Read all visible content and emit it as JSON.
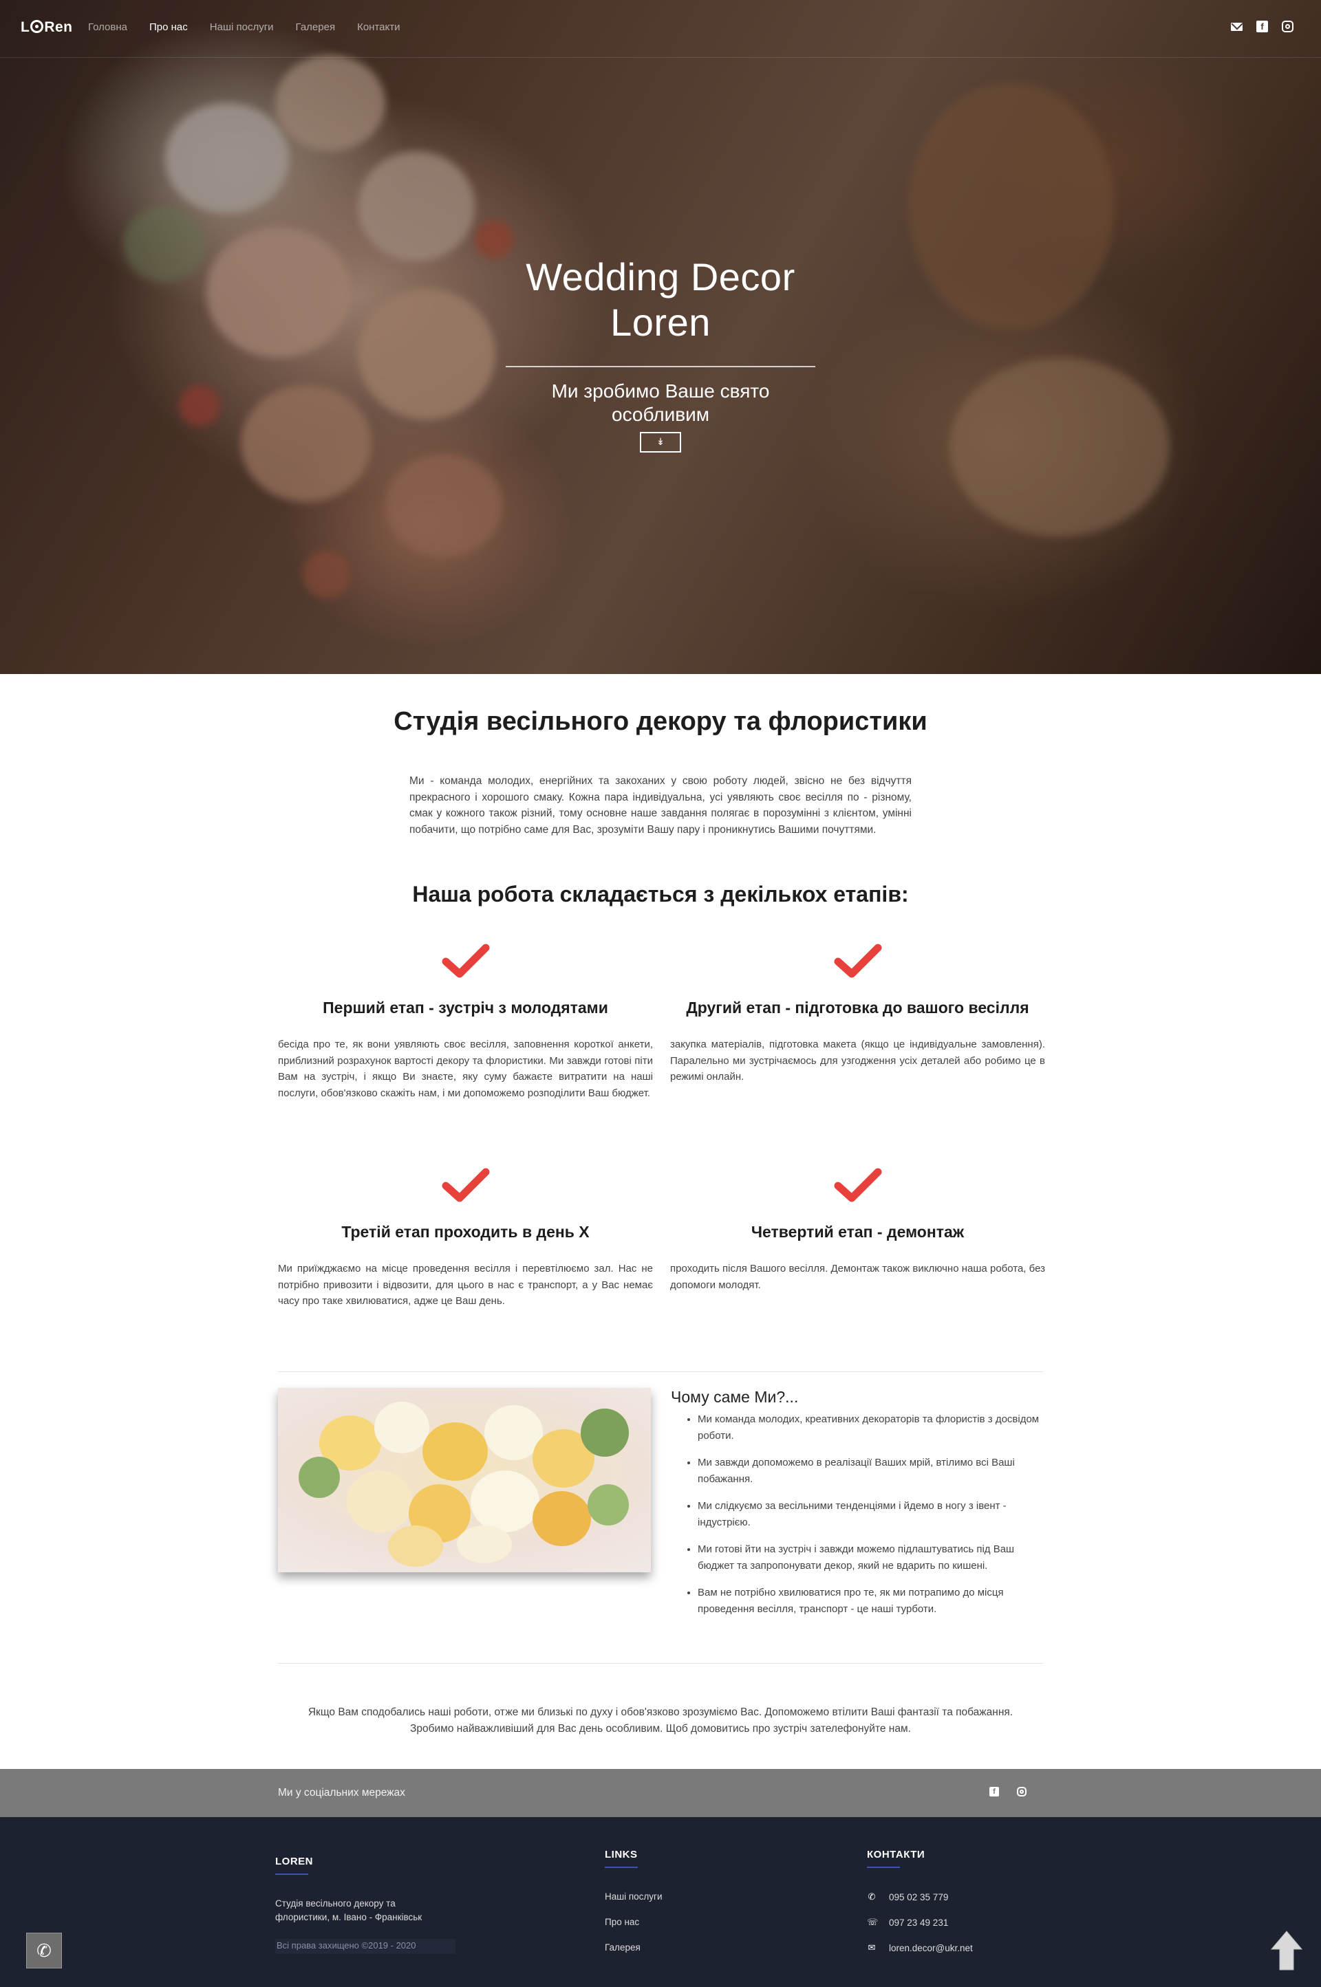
{
  "nav": {
    "logo": "LORen",
    "logo_left": "L",
    "logo_right": "Ren",
    "items": [
      {
        "label": "Головна"
      },
      {
        "label": "Про нас"
      },
      {
        "label": "Наші послуги"
      },
      {
        "label": "Галерея"
      },
      {
        "label": "Контакти"
      }
    ],
    "active_item": "Про нас",
    "social_icons": [
      "mail-icon",
      "facebook-icon",
      "instagram-icon"
    ]
  },
  "hero": {
    "title_line1": "Wedding Decor",
    "title_line2": "Loren",
    "subtitle_line1": "Ми зробимо Ваше свято",
    "subtitle_line2": "особливим",
    "scroll_icon": "chevron-double-down-icon"
  },
  "about": {
    "title": "Студія весільного декору та флористики",
    "text": "Ми - команда молодих, енергійних та закоханих у свою роботу людей, звісно не без відчуття прекрасного і хорошого смаку. Кожна пара індивідуальна, усі уявляють своє весілля по - різному, смак у кожного також різний, тому основне наше завдання полягає в порозумінні з клієнтом, умінні побачити, що потрібно саме для Вас, зрозуміти Вашу пару і проникнутись Вашими почуттями."
  },
  "stages": {
    "title": "Наша робота складається з декількох етапів:",
    "items": [
      {
        "title": "Перший етап - зустріч з молодятами",
        "text": "бесіда про те, як вони уявляють своє весілля, заповнення короткої анкети, приблизний розрахунок вартості декору та флористики. Ми завжди готові піти Вам на зустріч, і якщо Ви знаєте, яку суму бажаєте витратити на наші послуги, обов'язково скажіть нам, і ми допоможемо розподілити Ваш бюджет."
      },
      {
        "title": "Другий етап - підготовка до вашого весілля",
        "text": "закупка матеріалів, підготовка макета (якщо це індивідуальне замовлення). Паралельно ми зустрічаємось для узгодження усіх деталей або робимо це в режимі онлайн."
      },
      {
        "title": "Третій етап проходить в день Х",
        "text": "Ми приїжджаємо на місце проведення весілля і перевтілюємо зал. Нас не потрібно привозити і відвозити, для цього в нас є транспорт, а у Вас немає часу про таке хвилюватися, адже це Ваш день."
      },
      {
        "title": "Четвертий етап - демонтаж",
        "text": "проходить після Вашого весілля. Демонтаж також виключно наша робота, без допомоги молодят."
      }
    ],
    "check_color": "#e8403a"
  },
  "why": {
    "title": "Чому саме Ми?...",
    "items": [
      "Ми команда молодих, креативних декораторів та флористів з досвідом роботи.",
      "Ми завжди допоможемо в реалізації Ваших мрій, втілимо всі Ваші побажання.",
      "Ми слідкуємо за весільними тенденціями і йдемо в ногу з івент - індустрією.",
      "Ми готові йти на зустріч і завжди можемо підлаштуватись під Ваш бюджет та запропонувати декор, який не вдарить по кишені.",
      "Вам не потрібно хвилюватися про те, як ми потрапимо до місця проведення весілля, транспорт - це наші турботи."
    ]
  },
  "closing": {
    "line1": "Якщо Вам сподобались наші роботи, отже ми близькі по духу і обов'язково зрозуміємо Вас. Допоможемо втілити Ваші фантазії та побажання.",
    "line2": "Зробимо найважливіший для Вас день особливим. Щоб домовитись про зустріч зателефонуйте нам."
  },
  "social_bar": {
    "label": "Ми у соціальних мережах",
    "icons": [
      "facebook-icon",
      "instagram-icon"
    ],
    "color": "#7a7a7a"
  },
  "footer": {
    "brand": "LOREN",
    "description_line1": "Студія весільного декору та",
    "description_line2": "флористики, м. Івано - Франківськ",
    "copyright": "Всі права захищено ©2019 - 2020",
    "links_title": "LINKS",
    "links": [
      "Наші послуги",
      "Про нас",
      "Галерея"
    ],
    "contacts_title": "КОНТАКТИ",
    "contacts": [
      {
        "icon": "phone-icon",
        "value": "095 02 35 779"
      },
      {
        "icon": "viber-icon",
        "value": "097 23 49 231"
      },
      {
        "icon": "mail-icon",
        "value": "loren.decor@ukr.net"
      }
    ],
    "background": "#1d2230",
    "accent": "#3e51b3"
  }
}
